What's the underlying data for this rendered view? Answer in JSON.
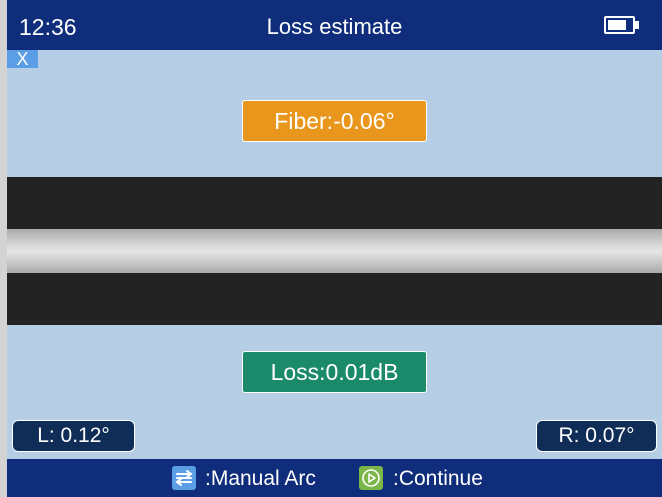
{
  "header": {
    "time": "12:36",
    "title": "Loss estimate",
    "battery_icon": "battery-icon"
  },
  "close_button": {
    "label": "X"
  },
  "fiber_angle": {
    "label": "Fiber:-0.06°"
  },
  "loss": {
    "label": "Loss:0.01dB"
  },
  "left_angle": {
    "label": "L: 0.12°"
  },
  "right_angle": {
    "label": "R: 0.07°"
  },
  "footer": {
    "manual_arc": {
      "icon": "manual-arc-icon",
      "label": ":Manual Arc"
    },
    "continue": {
      "icon": "continue-icon",
      "label": ":Continue"
    }
  },
  "colors": {
    "header_bg": "#0f2d7b",
    "screen_bg": "#b6cde6",
    "fiber_badge": "#e8961c",
    "loss_badge": "#1a8a6a",
    "angle_badge": "#0f2d57",
    "manual_arc_icon": "#5b9ee6",
    "continue_icon": "#7ab648"
  }
}
